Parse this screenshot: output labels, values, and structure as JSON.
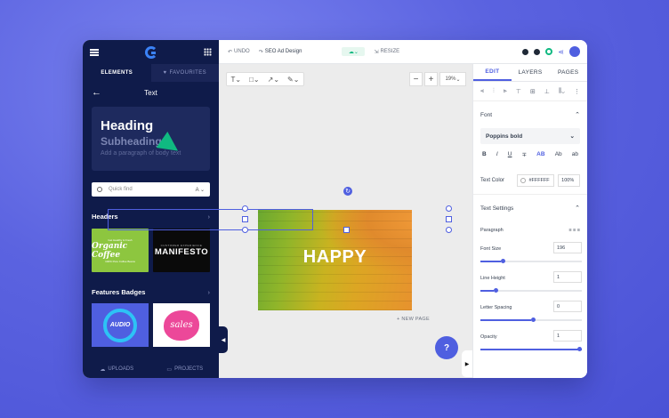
{
  "left": {
    "tabs": [
      "ELEMENTS",
      "FAVOURITES"
    ],
    "panel_title": "Text",
    "text_card": {
      "heading": "Heading",
      "subheading": "Subheading",
      "body": "Add a paragraph of body text"
    },
    "search": {
      "placeholder": "Quick find",
      "select_value": "A"
    },
    "sections": [
      {
        "title": "Headers"
      },
      {
        "title": "Features Badges"
      }
    ],
    "thumbs": {
      "organic_small": "Get Healthy & Fresh",
      "organic_big": "Organic Coffee",
      "organic_tag": "100% Pure Coffee Beans",
      "manifesto_small": "CUSTOMER EXPERIENCE",
      "manifesto_big": "MANIFESTO",
      "audio": "AUDIO",
      "sales": "sales"
    },
    "bottom": [
      "UPLOADS",
      "PROJECTS"
    ]
  },
  "topbar": {
    "undo": "UNDO",
    "redo_title": "SEO Ad Design",
    "resize": "RESIZE",
    "save_label": "☁"
  },
  "canvas": {
    "happy": "HAPPY",
    "new_page": "+ NEW PAGE",
    "zoom": "19%",
    "help": "?"
  },
  "right": {
    "tabs": [
      "EDIT",
      "LAYERS",
      "PAGES"
    ],
    "font_section": "Font",
    "font_name": "Poppins bold",
    "format": [
      "B",
      "I",
      "U",
      "∓",
      "AB",
      "Ab",
      "ab"
    ],
    "text_color_label": "Text Color",
    "text_color_hex": "#FFFFFF",
    "text_opacity": "100%",
    "text_settings": "Text Settings",
    "paragraph": "Paragraph",
    "props": [
      {
        "label": "Font Size",
        "value": "196",
        "fill": 0.2
      },
      {
        "label": "Line Height",
        "value": "1",
        "fill": 0.13
      },
      {
        "label": "Letter Spacing",
        "value": "0",
        "fill": 0.5
      },
      {
        "label": "Opacity",
        "value": "1",
        "fill": 1.0
      }
    ]
  },
  "colors": {
    "accent": "#4f5fe0",
    "panel": "#0f1b4a",
    "green": "#10b981"
  }
}
